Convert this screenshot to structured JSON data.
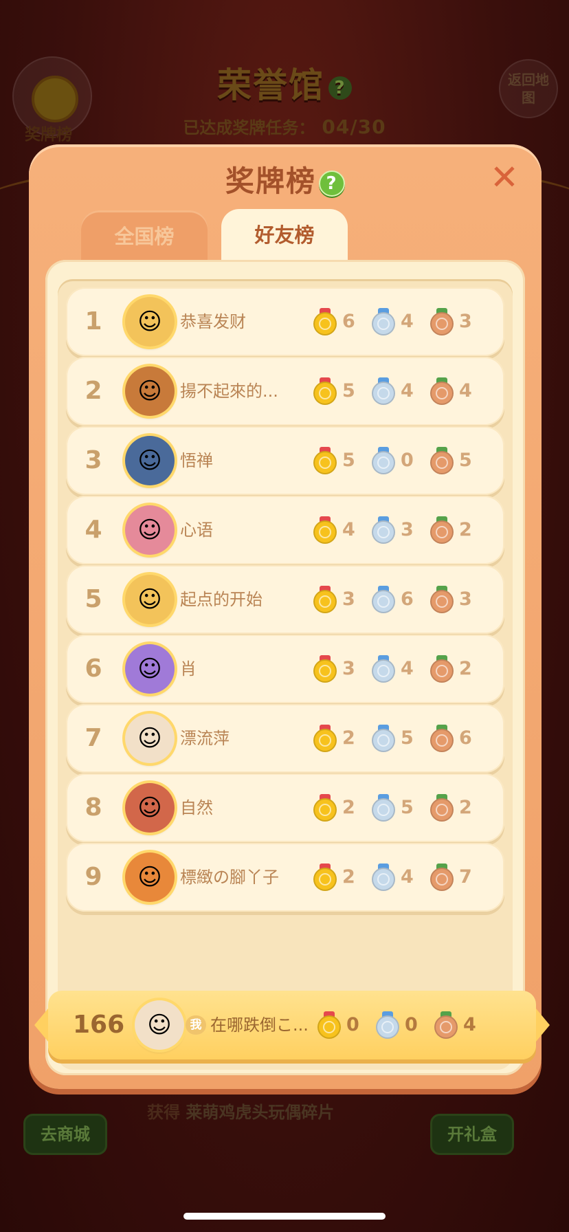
{
  "background": {
    "title": "荣誉馆",
    "title_help": "?",
    "progress_label": "已达成奖牌任务：",
    "progress_value": "04/30",
    "left_badge_label": "奖牌榜",
    "right_button_label": "返回地图",
    "bottom_left_button": "去商城",
    "bottom_right_button": "开礼盒",
    "bottom_text_prefix": "获得",
    "bottom_text_item": "莱萌鸡虎头玩偶碎片"
  },
  "modal": {
    "title": "奖牌榜",
    "help": "?",
    "close": "✕",
    "tabs": [
      {
        "label": "全国榜",
        "selected": false
      },
      {
        "label": "好友榜",
        "selected": true
      }
    ]
  },
  "leaderboard": [
    {
      "rank": "1",
      "name": "恭喜发财",
      "gold": "6",
      "silver": "4",
      "bronze": "3",
      "avatar_icon": "gold-frame-400-avatar-icon",
      "avatar_color": "#f3c35a"
    },
    {
      "rank": "2",
      "name": "揚不起來的...",
      "gold": "5",
      "silver": "4",
      "bronze": "4",
      "avatar_icon": "bear-chick-avatar-icon",
      "avatar_color": "#c87a3a"
    },
    {
      "rank": "3",
      "name": "悟禅",
      "gold": "5",
      "silver": "0",
      "bronze": "5",
      "avatar_icon": "photo-avatar-icon",
      "avatar_color": "#4a6a9a"
    },
    {
      "rank": "4",
      "name": "心语",
      "gold": "4",
      "silver": "3",
      "bronze": "2",
      "avatar_icon": "flower-frame-avatar-icon",
      "avatar_color": "#e58a9a"
    },
    {
      "rank": "5",
      "name": "起点的开始",
      "gold": "3",
      "silver": "6",
      "bronze": "3",
      "avatar_icon": "gold-frame-400-avatar-icon",
      "avatar_color": "#f3c35a"
    },
    {
      "rank": "6",
      "name": "肖",
      "gold": "3",
      "silver": "4",
      "bronze": "2",
      "avatar_icon": "purple-fish-avatar-icon",
      "avatar_color": "#a07ad8"
    },
    {
      "rank": "7",
      "name": "漂流萍",
      "gold": "2",
      "silver": "5",
      "bronze": "6",
      "avatar_icon": "crown-photo-avatar-icon",
      "avatar_color": "#f2e0c8"
    },
    {
      "rank": "8",
      "name": "自然",
      "gold": "2",
      "silver": "5",
      "bronze": "2",
      "avatar_icon": "carousel-avatar-icon",
      "avatar_color": "#d2674a"
    },
    {
      "rank": "9",
      "name": "標緻の腳丫子",
      "gold": "2",
      "silver": "4",
      "bronze": "7",
      "avatar_icon": "happy-god-avatar-icon",
      "avatar_color": "#e8883a"
    }
  ],
  "me": {
    "rank": "166",
    "tag": "我",
    "name": "在哪跌倒こ...",
    "gold": "0",
    "silver": "0",
    "bronze": "4",
    "avatar_icon": "crown-photo-avatar-icon",
    "avatar_color": "#f2e0c8"
  },
  "colors": {
    "modal_bg": "#f6b07a",
    "panel_bg": "#fdf0d0",
    "gold_medal": "#f7c21d",
    "silver_medal": "#c5d9ea",
    "bronze_medal": "#e59a6a",
    "help_green": "#6fbf3c"
  }
}
